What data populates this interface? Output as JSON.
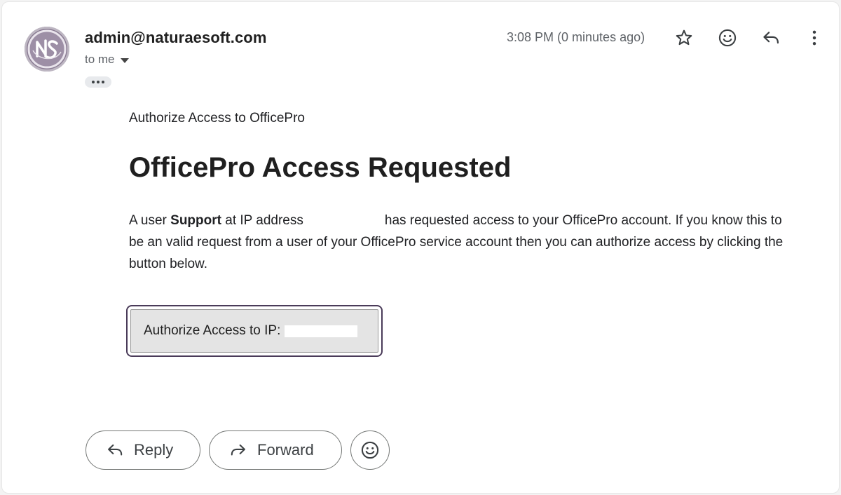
{
  "email": {
    "sender": "admin@naturaesoft.com",
    "recipient_label": "to me",
    "timestamp": "3:08 PM (0 minutes ago)",
    "preheader": "Authorize Access to OfficePro",
    "heading": "OfficePro Access Requested",
    "body": {
      "part1": "A user ",
      "user_name": "Support",
      "part2": " at IP address",
      "part3": "has requested access to your OfficePro account. If you know this to be an valid request from a user of your OfficePro service account then you can authorize access by clicking the button below."
    },
    "authorize_button_label": "Authorize Access to IP:"
  },
  "actions": {
    "reply_label": "Reply",
    "forward_label": "Forward"
  },
  "icons": {
    "avatar": "naturaesoft-logo",
    "star": "star-icon",
    "emoji": "emoji-icon",
    "reply": "reply-icon",
    "more": "more-vert-icon",
    "forward": "forward-icon",
    "caret": "caret-down-icon"
  },
  "colors": {
    "avatar_bg": "#8a7c93",
    "button_border": "#4a3b59",
    "button_fill": "#e4e4e4"
  }
}
